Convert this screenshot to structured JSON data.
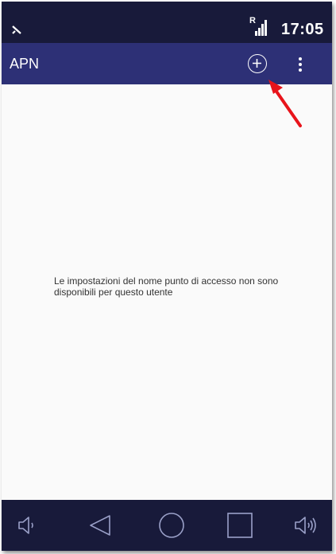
{
  "status_bar": {
    "left_icon": "no-sim-icon",
    "roaming_indicator": "R",
    "signal_icon": "signal-bars-icon",
    "time": "17:05"
  },
  "app_bar": {
    "title": "APN",
    "add_icon": "add-circle-icon",
    "overflow_icon": "more-vert-icon"
  },
  "content": {
    "message": "Le impostazioni del nome punto di accesso non sono disponibili per questo utente"
  },
  "annotation": {
    "arrow_color": "#e8141b"
  },
  "nav_bar": {
    "items": [
      "volume-down-icon",
      "back-icon",
      "home-icon",
      "recents-icon",
      "volume-up-icon"
    ]
  },
  "colors": {
    "status_bar": "#181a3a",
    "app_bar": "#2d3076",
    "background": "#fafafa"
  }
}
